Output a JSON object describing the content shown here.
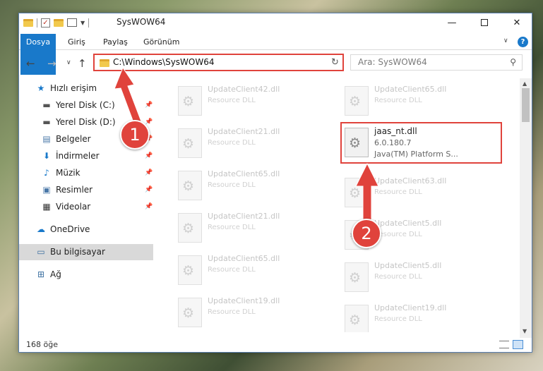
{
  "window": {
    "title": "SysWOW64"
  },
  "ribbon": {
    "tabs": [
      "Dosya",
      "Giriş",
      "Paylaş",
      "Görünüm"
    ]
  },
  "address": {
    "path": "C:\\Windows\\SysWOW64",
    "search_placeholder": "Ara: SysWOW64"
  },
  "nav": {
    "quick_access": "Hızlı erişim",
    "items": [
      {
        "label": "Yerel Disk (C:)",
        "icon": "drive-icon",
        "pinned": true
      },
      {
        "label": "Yerel Disk (D:)",
        "icon": "drive-icon",
        "pinned": true
      },
      {
        "label": "Belgeler",
        "icon": "documents-icon",
        "pinned": true
      },
      {
        "label": "İndirmeler",
        "icon": "download-icon",
        "pinned": true
      },
      {
        "label": "Müzik",
        "icon": "music-icon",
        "pinned": true
      },
      {
        "label": "Resimler",
        "icon": "pictures-icon",
        "pinned": true
      },
      {
        "label": "Videolar",
        "icon": "videos-icon",
        "pinned": true
      }
    ],
    "onedrive": "OneDrive",
    "this_pc": "Bu bilgisayar",
    "network": "Ağ"
  },
  "files": {
    "left_column": [
      {
        "name": "UpdateClient42.dll",
        "desc": "Resource DLL"
      },
      {
        "name": "UpdateClient21.dll",
        "desc": "Resource DLL"
      },
      {
        "name": "UpdateClient65.dll",
        "desc": "Resource DLL"
      },
      {
        "name": "UpdateClient21.dll",
        "desc": "Resource DLL"
      },
      {
        "name": "UpdateClient65.dll",
        "desc": "Resource DLL"
      },
      {
        "name": "UpdateClient19.dll",
        "desc": "Resource DLL"
      }
    ],
    "right_column": [
      {
        "name": "UpdateClient65.dll",
        "desc": "Resource DLL"
      },
      {
        "name": "UpdateClient63.dll",
        "desc": "Resource DLL"
      },
      {
        "name": "UpdateClient5.dll",
        "desc": "Resource DLL"
      },
      {
        "name": "UpdateClient5.dll",
        "desc": "Resource DLL"
      },
      {
        "name": "UpdateClient19.dll",
        "desc": "Resource DLL"
      }
    ],
    "highlighted": {
      "name": "jaas_nt.dll",
      "version": "6.0.180.7",
      "description": "Java(TM) Platform S..."
    }
  },
  "status": {
    "count": "168 öğe"
  },
  "callouts": [
    "1",
    "2"
  ],
  "colors": {
    "accent": "#1979ca",
    "highlight": "#e0433c"
  }
}
